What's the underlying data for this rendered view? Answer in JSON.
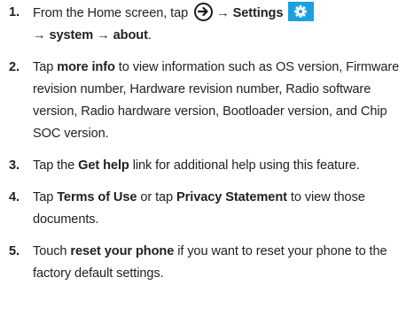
{
  "steps": [
    {
      "number": "1.",
      "part_a": "From the Home screen, tap",
      "arrow": "→",
      "settings": "Settings",
      "part_b": "system",
      "part_c": "about",
      "period": "."
    },
    {
      "number": "2.",
      "pre": "Tap",
      "bold": "more info",
      "post": "to view information such as OS version, Firmware revision number, Hardware revision number, Radio software version, Radio hardware version, Bootloader version, and Chip SOC version."
    },
    {
      "number": "3.",
      "pre": "Tap the",
      "bold": "Get help",
      "post": "link for additional help using this feature."
    },
    {
      "number": "4.",
      "pre": "Tap",
      "bold_a": "Terms of Use",
      "mid": "or tap",
      "bold_b": "Privacy Statement",
      "post": "to view those documents."
    },
    {
      "number": "5.",
      "pre": "Touch",
      "bold": "reset your phone",
      "post": "if you want to reset your phone to the factory default settings."
    }
  ],
  "icons": {
    "start_arrow": "right-arrow-circle-icon",
    "settings": "gear-icon",
    "settings_color": "#1aa1e1"
  }
}
